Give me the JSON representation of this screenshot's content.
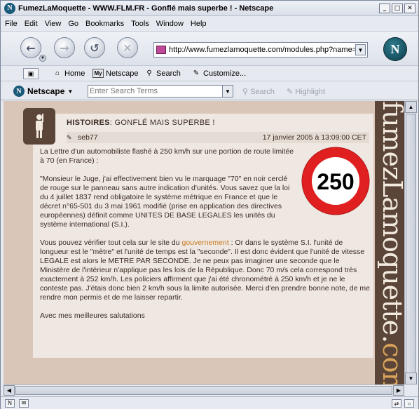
{
  "window": {
    "title": "FumezLaMoquette - WWW.FLM.FR - Gonflé mais superbe ! - Netscape",
    "app_icon": "N",
    "buttons": {
      "minimize": "_",
      "maximize": "□",
      "close": "✕"
    }
  },
  "menu": [
    "File",
    "Edit",
    "View",
    "Go",
    "Bookmarks",
    "Tools",
    "Window",
    "Help"
  ],
  "navigation": {
    "url": "http://www.fumezlamoquette.com/modules.php?name=",
    "throbber": "N"
  },
  "personal_toolbar": {
    "home": "Home",
    "netscape": "Netscape",
    "search": "Search",
    "customize": "Customize..."
  },
  "search_toolbar": {
    "brand": "Netscape",
    "placeholder": "Enter Search Terms",
    "search": "Search",
    "highlight": "Highlight"
  },
  "site": {
    "logo_text_main": "fumezLamoquette.",
    "logo_text_accent": "com"
  },
  "article": {
    "category": "HISTOIRES",
    "title": ": GONFLÉ MAIS SUPERBE !",
    "author": "seb77",
    "date": "17 janvier 2005 à 13:09:00 CET",
    "sign_value": "250",
    "p1": "La Lettre d'un automobiliste flashé à 250 km/h sur une portion de route limitée à 70 (en France) :",
    "p2": "\"Monsieur le Juge, j'ai effectivement bien vu le marquage \"70\" en noir cerclé de rouge sur le panneau sans autre indication d'unités. Vous savez que la loi du 4 juillet 1837 rend obligatoire le système métrique en France et que le décret n°65-501 du 3 mai 1961 modifié (prise en application des directives européennes) définit comme UNITES DE BASE LEGALES les unités du système international (S.I.).",
    "p3_before": "Vous pouvez vérifier tout cela sur le site du ",
    "p3_link": "gouvernement",
    "p3_after": " : Or dans le système S.I. l'unité de longueur est le \"mètre\" et l'unité de temps est la \"seconde\". Il est donc évident que l'unité de vitesse LEGALE est alors le METRE PAR SECONDE. Je ne peux pas imaginer une seconde que le Ministère de l'intérieur n'applique pas les lois de la République. Donc 70 m/s cela correspond très exactement à 252 km/h. Les policiers affirment que j'ai été chronométré à 250 km/h et je ne le conteste pas. J'étais donc bien 2 km/h sous la limite autorisée. Merci d'en prendre bonne note, de me rendre mon permis et de me laisser repartir.",
    "p4": "Avec mes meilleures salutations"
  },
  "colors": {
    "page_bg": "#d9c6b8",
    "article_bg": "#efe8e2",
    "side_logo_bg": "#5a4538",
    "link": "#c87a22",
    "sign_ring": "#e02020"
  }
}
